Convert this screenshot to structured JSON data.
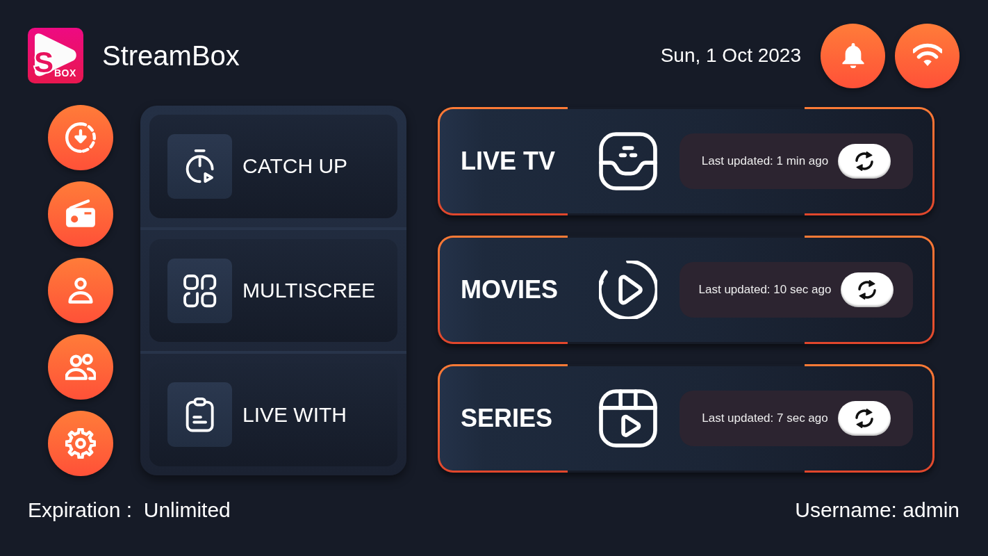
{
  "header": {
    "logo": {
      "letter": "S",
      "text": "BOX"
    },
    "app_name": "StreamBox",
    "date": "Sun, 1 Oct 2023",
    "actions": [
      {
        "kind": "notifications"
      },
      {
        "kind": "wifi"
      }
    ]
  },
  "sidebar": {
    "items": [
      {
        "kind": "download"
      },
      {
        "kind": "radio"
      },
      {
        "kind": "profile"
      },
      {
        "kind": "accounts"
      },
      {
        "kind": "settings"
      }
    ]
  },
  "menu": {
    "items": [
      {
        "kind": "catch_up",
        "label": "CATCH UP"
      },
      {
        "kind": "multiscreen",
        "label": "MULTISCREE"
      },
      {
        "kind": "live_with",
        "label": "LIVE WITH"
      }
    ]
  },
  "categories": [
    {
      "kind": "live",
      "title": "LIVE TV",
      "status": "Last updated: 1 min ago"
    },
    {
      "kind": "movies",
      "title": "MOVIES",
      "status": "Last updated: 10 sec ago"
    },
    {
      "kind": "series",
      "title": "SERIES",
      "status": "Last updated: 7 sec ago"
    }
  ],
  "footer": {
    "expiration": "Expiration :  Unlimited",
    "username": "Username: admin"
  }
}
